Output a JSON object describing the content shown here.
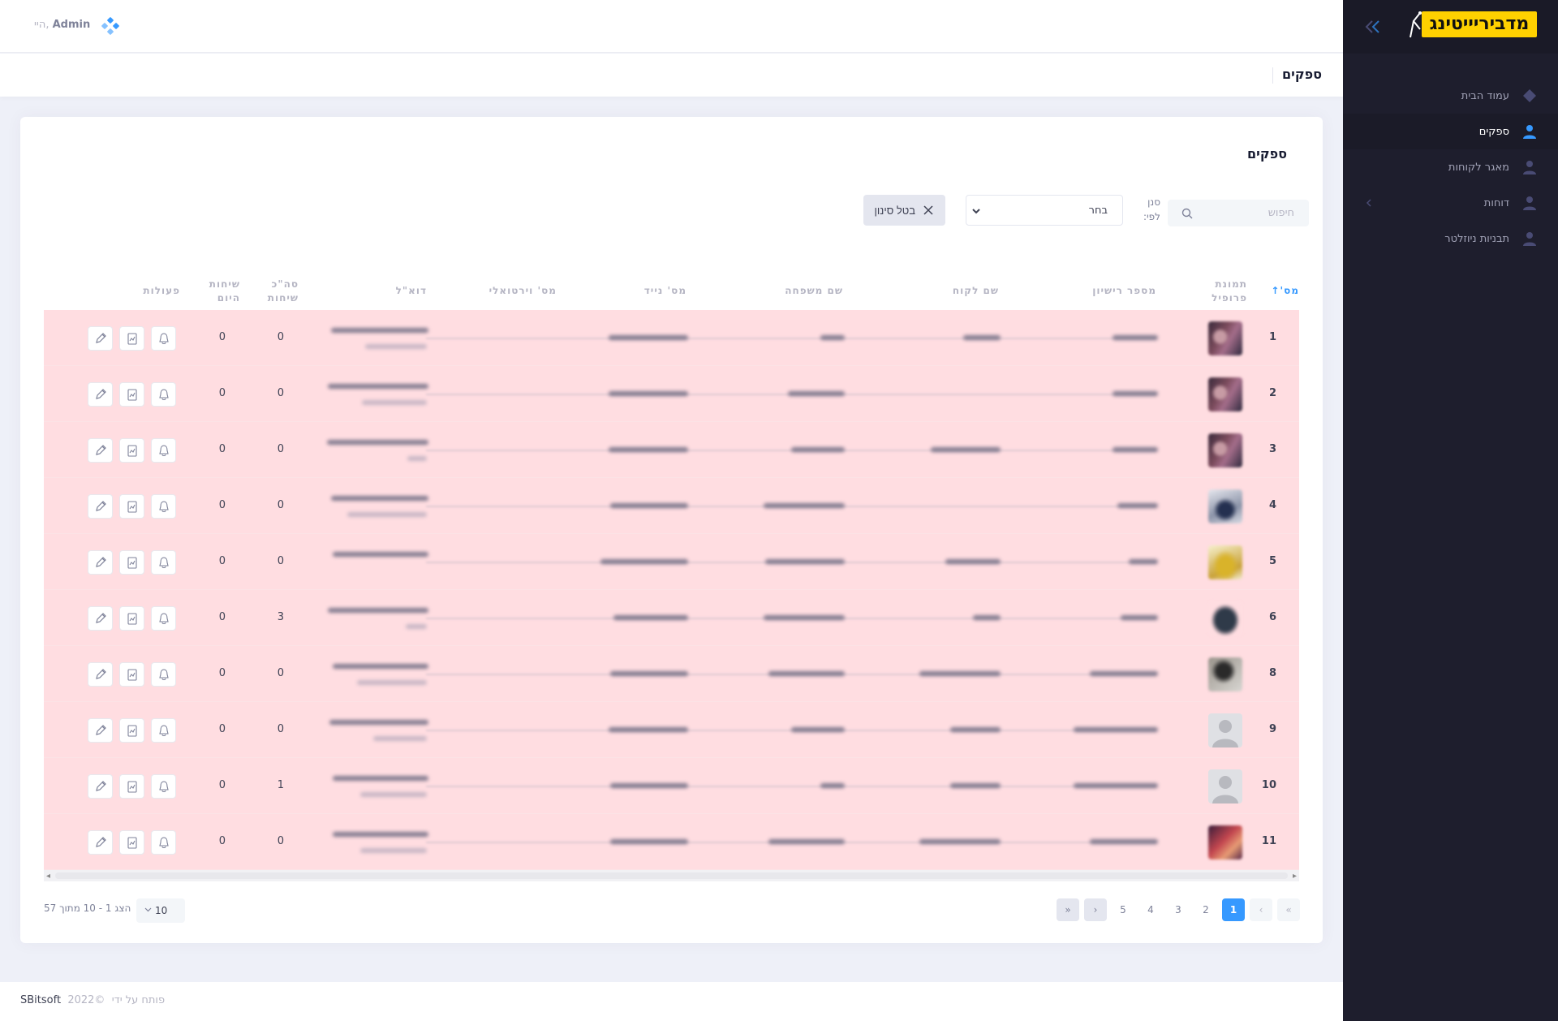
{
  "header": {
    "greeting": "היי,",
    "username": "Admin"
  },
  "sidebar": {
    "logo_text": "מדביריייטינג",
    "items": [
      {
        "label": "עמוד הבית",
        "icon": "diamond-icon"
      },
      {
        "label": "ספקים",
        "icon": "user-icon",
        "active": true
      },
      {
        "label": "מאגר לקוחות",
        "icon": "user-icon"
      },
      {
        "label": "דוחות",
        "icon": "user-icon",
        "has_submenu": true
      },
      {
        "label": "תבניות ניוזלטר",
        "icon": "user-icon"
      }
    ]
  },
  "subheader": {
    "title": "ספקים"
  },
  "card": {
    "title": "ספקים",
    "search_placeholder": "חיפוש",
    "filter_label": "סנן לפי:",
    "filter_select_value": "בחר",
    "clear_filter_label": "בטל סינון"
  },
  "table": {
    "columns": {
      "num": "מס'",
      "profile": "תמונת פרופיל",
      "license": "מספר רישיון",
      "customer_name": "שם לקוח",
      "last_name": "שם משפחה",
      "mobile": "מס' נייד",
      "virtual": "מס' וירטואלי",
      "email": "דוא\"ל",
      "total_calls": "סה\"כ שיחות",
      "calls_today": "שיחות היום",
      "actions": "פעולות"
    },
    "rows": [
      {
        "num": "1",
        "avatar": "av-a",
        "total_calls": "0",
        "calls_today": "0"
      },
      {
        "num": "2",
        "avatar": "av-a",
        "total_calls": "0",
        "calls_today": "0"
      },
      {
        "num": "3",
        "avatar": "av-a",
        "total_calls": "0",
        "calls_today": "0"
      },
      {
        "num": "4",
        "avatar": "av-b",
        "total_calls": "0",
        "calls_today": "0"
      },
      {
        "num": "5",
        "avatar": "av-c",
        "total_calls": "0",
        "calls_today": "0"
      },
      {
        "num": "6",
        "avatar": "av-d",
        "total_calls": "3",
        "calls_today": "0"
      },
      {
        "num": "8",
        "avatar": "av-e",
        "total_calls": "0",
        "calls_today": "0"
      },
      {
        "num": "9",
        "avatar": "av-ph",
        "total_calls": "0",
        "calls_today": "0"
      },
      {
        "num": "10",
        "avatar": "av-ph",
        "total_calls": "1",
        "calls_today": "0"
      },
      {
        "num": "11",
        "avatar": "av-f",
        "total_calls": "0",
        "calls_today": "0"
      }
    ]
  },
  "pagination": {
    "pages": [
      "1",
      "2",
      "3",
      "4",
      "5"
    ],
    "active_page": "1",
    "per_page": "10",
    "info": "הצג 1 - 10 מתוך 57"
  },
  "footer": {
    "year": "©2022",
    "developed_by": "פותח על ידי",
    "company": "SBitsoft"
  },
  "colors": {
    "sidebar_bg": "#1e1e2d",
    "accent": "#3699ff",
    "row_highlight": "#ffdde1",
    "logo_bg": "#ffd100"
  }
}
